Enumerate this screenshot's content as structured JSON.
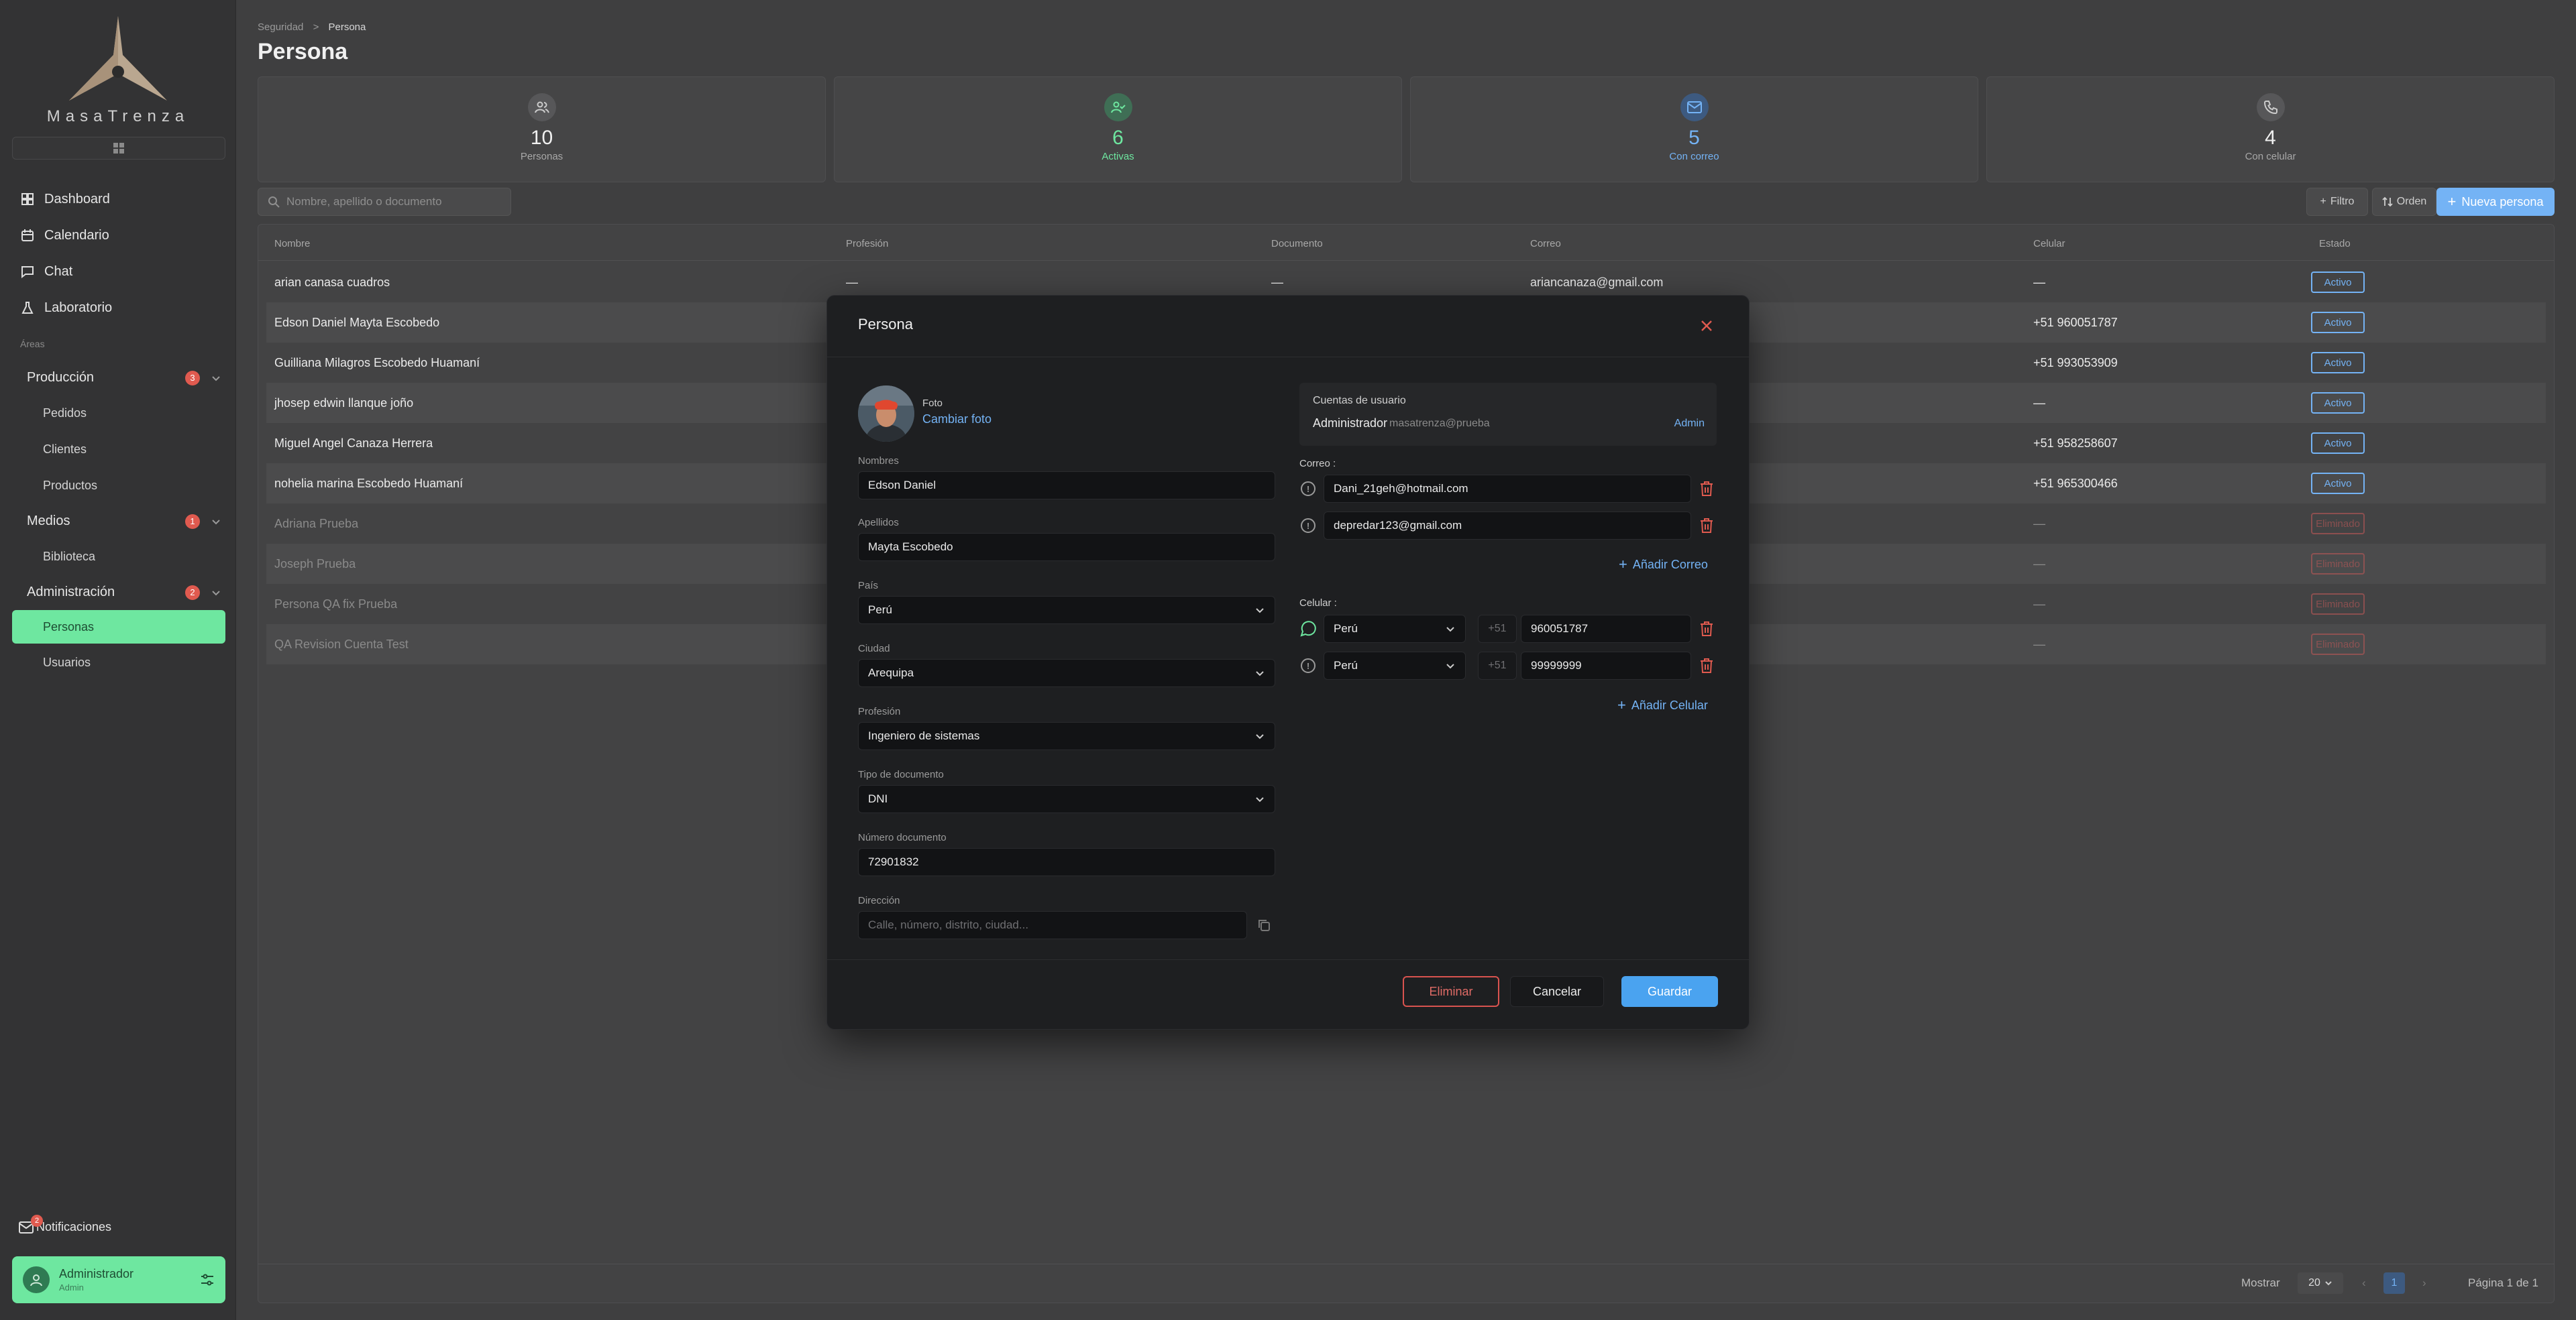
{
  "brand": {
    "name": "MasaTrenza"
  },
  "sidebar": {
    "nav": [
      {
        "label": "Dashboard",
        "icon": "dashboard-icon"
      },
      {
        "label": "Calendario",
        "icon": "calendar-icon"
      },
      {
        "label": "Chat",
        "icon": "chat-icon"
      },
      {
        "label": "Laboratorio",
        "icon": "flask-icon"
      }
    ],
    "areas_label": "Áreas",
    "groups": [
      {
        "label": "Producción",
        "badge": "3",
        "subs": [
          "Pedidos",
          "Clientes",
          "Productos"
        ]
      },
      {
        "label": "Medios",
        "badge": "1",
        "subs": [
          "Biblioteca"
        ]
      },
      {
        "label": "Administración",
        "badge": "2",
        "subs": [
          "Personas",
          "Usuarios"
        ]
      }
    ],
    "notifications": {
      "label": "Notificaciones",
      "badge": "2"
    },
    "user": {
      "name": "Administrador",
      "role": "Admin"
    }
  },
  "breadcrumb": {
    "parent": "Seguridad",
    "separator": ">",
    "current": "Persona"
  },
  "page": {
    "title": "Persona"
  },
  "stats": [
    {
      "value": "10",
      "label": "Personas"
    },
    {
      "value": "6",
      "label": "Activas"
    },
    {
      "value": "5",
      "label": "Con correo"
    },
    {
      "value": "4",
      "label": "Con celular"
    }
  ],
  "toolbar": {
    "search_placeholder": "Nombre, apellido o documento",
    "filter_label": "Filtro",
    "order_label": "Orden",
    "new_label": "Nueva persona"
  },
  "table": {
    "columns": [
      "Nombre",
      "Profesión",
      "Documento",
      "Correo",
      "Celular",
      "Estado"
    ],
    "rows": [
      {
        "name": "arian canasa cuadros",
        "prof": "—",
        "doc": "—",
        "mail": "ariancanaza@gmail.com",
        "cel": "—",
        "status": "Activo"
      },
      {
        "name": "Edson Daniel Mayta Escobedo",
        "prof": "",
        "doc": "",
        "mail": "",
        "cel": "+51 960051787",
        "status": "Activo"
      },
      {
        "name": "Guilliana Milagros Escobedo Huamaní",
        "prof": "",
        "doc": "",
        "mail": "",
        "cel": "+51 993053909",
        "status": "Activo"
      },
      {
        "name": "jhosep edwin llanque joño",
        "prof": "",
        "doc": "",
        "mail": "",
        "cel": "—",
        "status": "Activo"
      },
      {
        "name": "Miguel Angel Canaza Herrera",
        "prof": "",
        "doc": "",
        "mail": "",
        "cel": "+51 958258607",
        "status": "Activo"
      },
      {
        "name": "nohelia marina Escobedo Huamaní",
        "prof": "",
        "doc": "",
        "mail": "",
        "cel": "+51 965300466",
        "status": "Activo"
      },
      {
        "name": "Adriana Prueba",
        "prof": "",
        "doc": "",
        "mail": "",
        "cel": "—",
        "status": "Eliminado"
      },
      {
        "name": "Joseph Prueba",
        "prof": "",
        "doc": "",
        "mail": "",
        "cel": "—",
        "status": "Eliminado"
      },
      {
        "name": "Persona QA fix Prueba",
        "prof": "",
        "doc": "",
        "mail": "",
        "cel": "—",
        "status": "Eliminado"
      },
      {
        "name": "QA Revision Cuenta Test",
        "prof": "",
        "doc": "",
        "mail": "",
        "cel": "—",
        "status": "Eliminado"
      }
    ],
    "footer": {
      "show_label": "Mostrar",
      "page_size": "20",
      "current_page": "1",
      "page_info": "Página 1 de 1"
    }
  },
  "modal": {
    "title": "Persona",
    "photo_label": "Foto",
    "change_photo": "Cambiar foto",
    "fields": {
      "nombres": {
        "label": "Nombres",
        "value": "Edson Daniel"
      },
      "apellidos": {
        "label": "Apellidos",
        "value": "Mayta Escobedo"
      },
      "pais": {
        "label": "País",
        "value": "Perú"
      },
      "ciudad": {
        "label": "Ciudad",
        "value": "Arequipa"
      },
      "profesion": {
        "label": "Profesión",
        "value": "Ingeniero de sistemas"
      },
      "tipo_doc": {
        "label": "Tipo de documento",
        "value": "DNI"
      },
      "num_doc": {
        "label": "Número documento",
        "value": "72901832"
      },
      "direccion": {
        "label": "Dirección",
        "placeholder": "Calle, número, distrito, ciudad..."
      }
    },
    "accounts": {
      "title": "Cuentas de usuario",
      "name": "Administrador",
      "email": "masatrenza@prueba",
      "role": "Admin"
    },
    "emails": {
      "label": "Correo :",
      "items": [
        "Dani_21geh@hotmail.com",
        "depredar123@gmail.com"
      ],
      "add_label": "Añadir Correo"
    },
    "phones": {
      "label": "Celular :",
      "items": [
        {
          "country": "Perú",
          "prefix": "+51",
          "number": "960051787"
        },
        {
          "country": "Perú",
          "prefix": "+51",
          "number": "99999999"
        }
      ],
      "add_label": "Añadir Celular"
    },
    "buttons": {
      "delete": "Eliminar",
      "cancel": "Cancelar",
      "save": "Guardar"
    }
  },
  "colors": {
    "accent_green": "#6ee7a0",
    "accent_blue": "#74b3f5",
    "danger": "#e05a4f"
  }
}
